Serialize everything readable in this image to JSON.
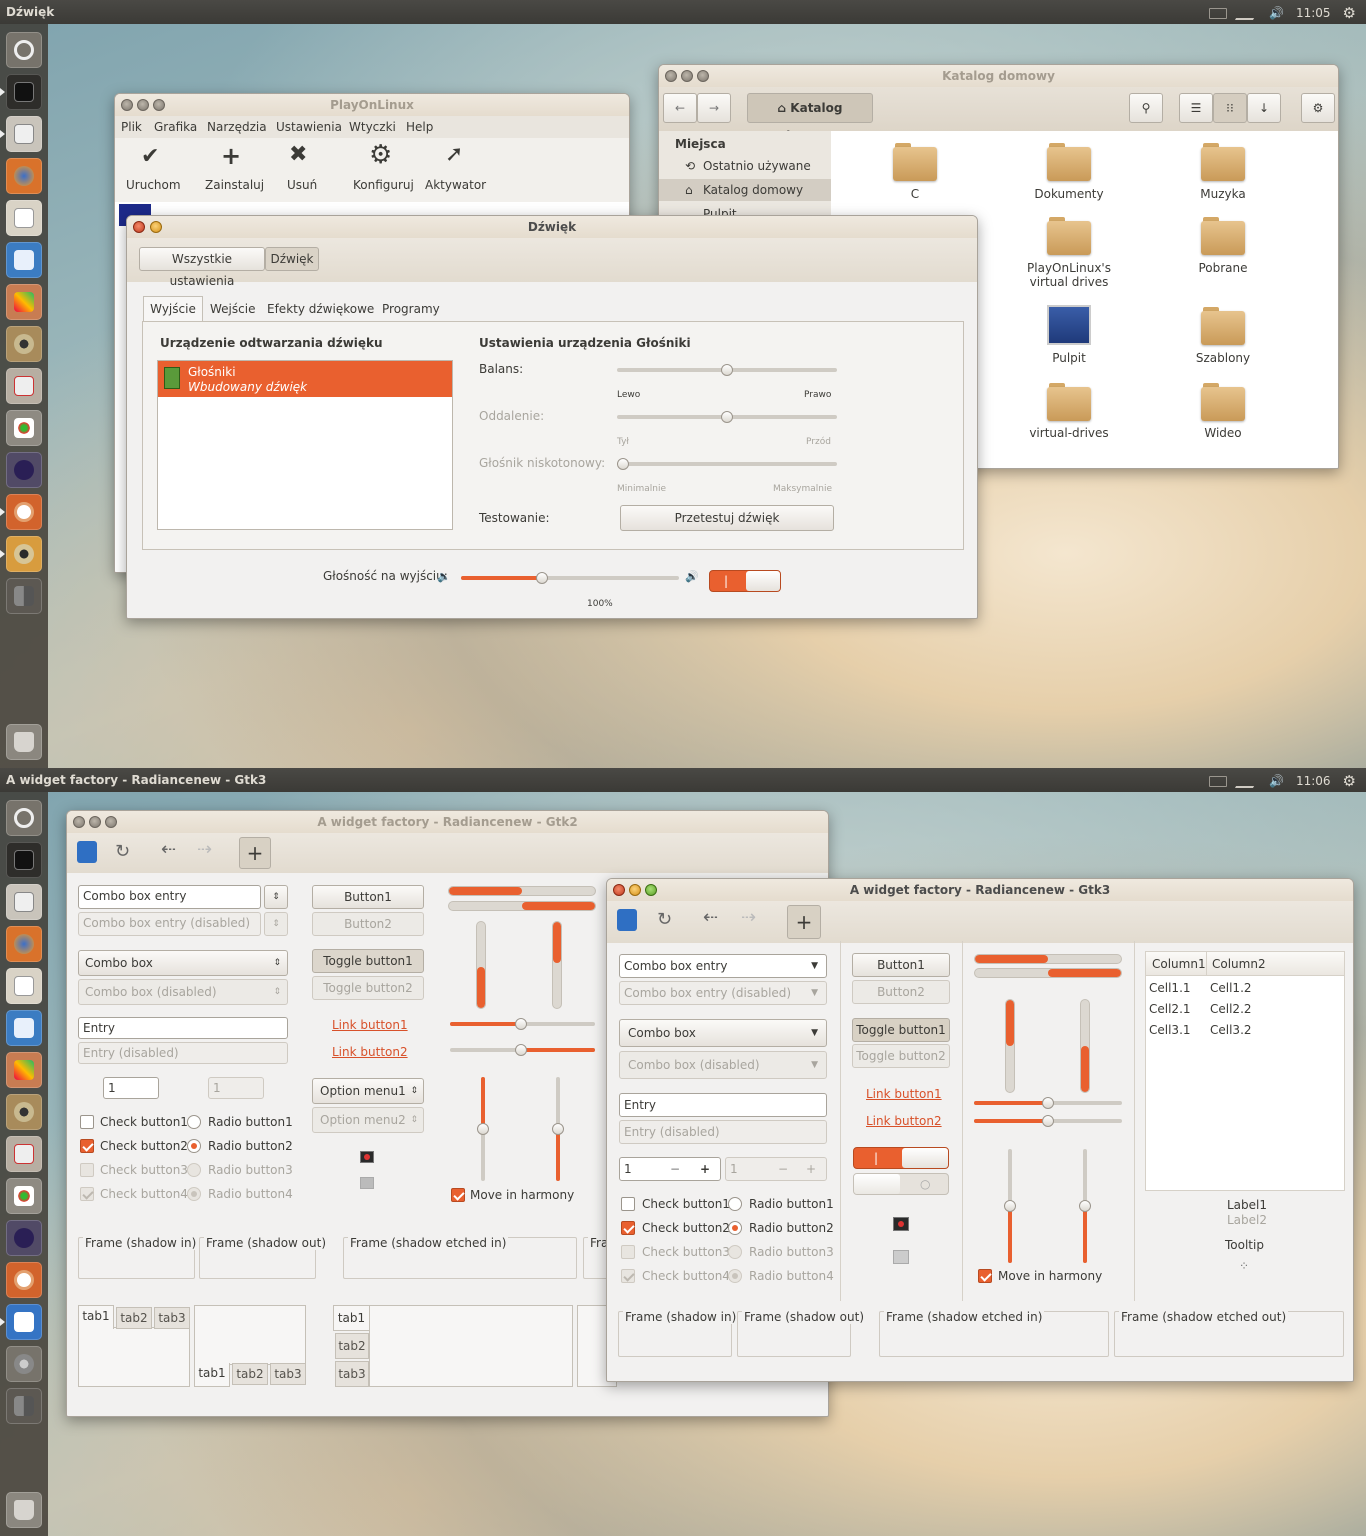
{
  "top": {
    "panel_title": "Dźwięk",
    "clock": "11:05",
    "playonlinux": {
      "title": "PlayOnLinux",
      "menu": [
        "Plik",
        "Grafika",
        "Narzędzia",
        "Ustawienia",
        "Wtyczki",
        "Help"
      ],
      "toolbar": [
        "Uruchom",
        "Zainstaluj",
        "Usuń",
        "Konfiguruj",
        "Aktywator"
      ]
    },
    "files": {
      "title": "Katalog domowy",
      "location": "Katalog domowy",
      "sidebar_header": "Miejsca",
      "sidebar": [
        "Ostatnio używane",
        "Katalog domowy",
        "Pulpit"
      ],
      "items": [
        "C",
        "Dokumenty",
        "Muzyka",
        "PlayOnLinux's virtual drives",
        "Pobrane",
        "Pulpit",
        "Szablony",
        "virtual-drives",
        "Wideo"
      ]
    },
    "sound": {
      "title": "Dźwięk",
      "breadcrumb": [
        "Wszystkie ustawienia",
        "Dźwięk"
      ],
      "tabs": [
        "Wyjście",
        "Wejście",
        "Efekty dźwiękowe",
        "Programy"
      ],
      "device_header": "Urządzenie odtwarzania dźwięku",
      "device_name": "Głośniki",
      "device_desc": "Wbudowany dźwięk",
      "settings_header": "Ustawienia urządzenia Głośniki",
      "balance_label": "Balans:",
      "balance_left": "Lewo",
      "balance_right": "Prawo",
      "balance_value": 0.5,
      "fade_label": "Oddalenie:",
      "fade_left": "Tył",
      "fade_right": "Przód",
      "sub_label": "Głośnik niskotonowy:",
      "sub_left": "Minimalnie",
      "sub_right": "Maksymalnie",
      "test_label": "Testowanie:",
      "test_button": "Przetestuj dźwięk",
      "volume_label": "Głośność na wyjściu:",
      "volume_pct": "100%",
      "volume_value": 0.37
    }
  },
  "bottom": {
    "panel_title": "A widget factory - Radiancenew - Gtk3",
    "clock": "11:06",
    "gtk2": {
      "title": "A widget factory - Radiancenew - Gtk2",
      "combo_entry": "Combo box entry",
      "combo_entry_dis": "Combo box entry (disabled)",
      "combo": "Combo box",
      "combo_dis": "Combo box (disabled)",
      "entry": "Entry",
      "entry_dis": "Entry (disabled)",
      "spin": "1",
      "spin_dis": "1",
      "checks": [
        "Check button1",
        "Check button2",
        "Check button3",
        "Check button4"
      ],
      "radios": [
        "Radio button1",
        "Radio button2",
        "Radio button3",
        "Radio button4"
      ],
      "button1": "Button1",
      "button2": "Button2",
      "toggle1": "Toggle button1",
      "toggle2": "Toggle button2",
      "link1": "Link button1",
      "link2": "Link button2",
      "option1": "Option menu1",
      "option2": "Option menu2",
      "harmony": "Move in harmony",
      "frames": [
        "Frame (shadow in)",
        "Frame (shadow out)",
        "Frame (shadow etched in)",
        "Fra"
      ],
      "tabs": [
        "tab1",
        "tab2",
        "tab3"
      ]
    },
    "gtk3": {
      "title": "A widget factory - Radiancenew - Gtk3",
      "combo_entry": "Combo box entry",
      "combo_entry_dis": "Combo box entry (disabled)",
      "combo": "Combo box",
      "combo_dis": "Combo box (disabled)",
      "entry": "Entry",
      "entry_dis": "Entry (disabled)",
      "spin": "1",
      "spin_dis": "1",
      "checks": [
        "Check button1",
        "Check button2",
        "Check button3",
        "Check button4"
      ],
      "radios": [
        "Radio button1",
        "Radio button2",
        "Radio button3",
        "Radio button4"
      ],
      "button1": "Button1",
      "button2": "Button2",
      "toggle1": "Toggle button1",
      "toggle2": "Toggle button2",
      "link1": "Link button1",
      "link2": "Link button2",
      "harmony": "Move in harmony",
      "columns": [
        "Column1",
        "Column2"
      ],
      "rows": [
        [
          "Cell1.1",
          "Cell1.2"
        ],
        [
          "Cell2.1",
          "Cell2.2"
        ],
        [
          "Cell3.1",
          "Cell3.2"
        ]
      ],
      "label1": "Label1",
      "label2": "Label2",
      "tooltip": "Tooltip",
      "frames": [
        "Frame (shadow in)",
        "Frame (shadow out)",
        "Frame (shadow etched in)",
        "Frame (shadow etched out)"
      ]
    }
  },
  "colors": {
    "accent": "#e9602f",
    "panel": "#3c3b37",
    "window": "#f2f1f0"
  }
}
